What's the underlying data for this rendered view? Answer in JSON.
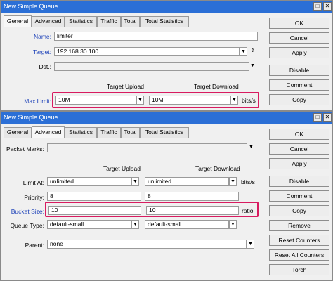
{
  "win1": {
    "title": "New Simple Queue",
    "tabs": [
      "General",
      "Advanced",
      "Statistics",
      "Traffic",
      "Total",
      "Total Statistics"
    ],
    "name_label": "Name:",
    "name_value": "limiter",
    "target_label": "Target:",
    "target_value": "192.168.30.100",
    "dst_label": "Dst.:",
    "dst_value": "",
    "col_upload": "Target Upload",
    "col_download": "Target Download",
    "maxlimit_label": "Max Limit:",
    "maxlimit_upload": "10M",
    "maxlimit_download": "10M",
    "unit": "bits/s",
    "buttons": [
      "OK",
      "Cancel",
      "Apply",
      "Disable",
      "Comment",
      "Copy"
    ]
  },
  "win2": {
    "title": "New Simple Queue",
    "tabs": [
      "General",
      "Advanced",
      "Statistics",
      "Traffic",
      "Total",
      "Total Statistics"
    ],
    "packet_marks_label": "Packet Marks:",
    "packet_marks_value": "",
    "col_upload": "Target Upload",
    "col_download": "Target Download",
    "limit_at_label": "Limit At:",
    "limit_at_upload": "unlimited",
    "limit_at_download": "unlimited",
    "limit_at_unit": "bits/s",
    "priority_label": "Priority:",
    "priority_upload": "8",
    "priority_download": "8",
    "bucket_label": "Bucket Size:",
    "bucket_upload": "10",
    "bucket_download": "10",
    "bucket_unit": "ratio",
    "queue_type_label": "Queue Type:",
    "queue_type_upload": "default-small",
    "queue_type_download": "default-small",
    "parent_label": "Parent:",
    "parent_value": "none",
    "buttons": [
      "OK",
      "Cancel",
      "Apply",
      "Disable",
      "Comment",
      "Copy",
      "Remove",
      "Reset Counters",
      "Reset All Counters",
      "Torch"
    ]
  },
  "icons": {
    "maximize": "maximize-icon",
    "close": "close-icon",
    "dropdown": "dropdown-arrow-icon",
    "remove_entry": "up-down-arrow-icon"
  },
  "colors": {
    "titlebar": "#2b6fd6",
    "link_label": "#1a3fb8",
    "highlight": "#d81b60"
  }
}
